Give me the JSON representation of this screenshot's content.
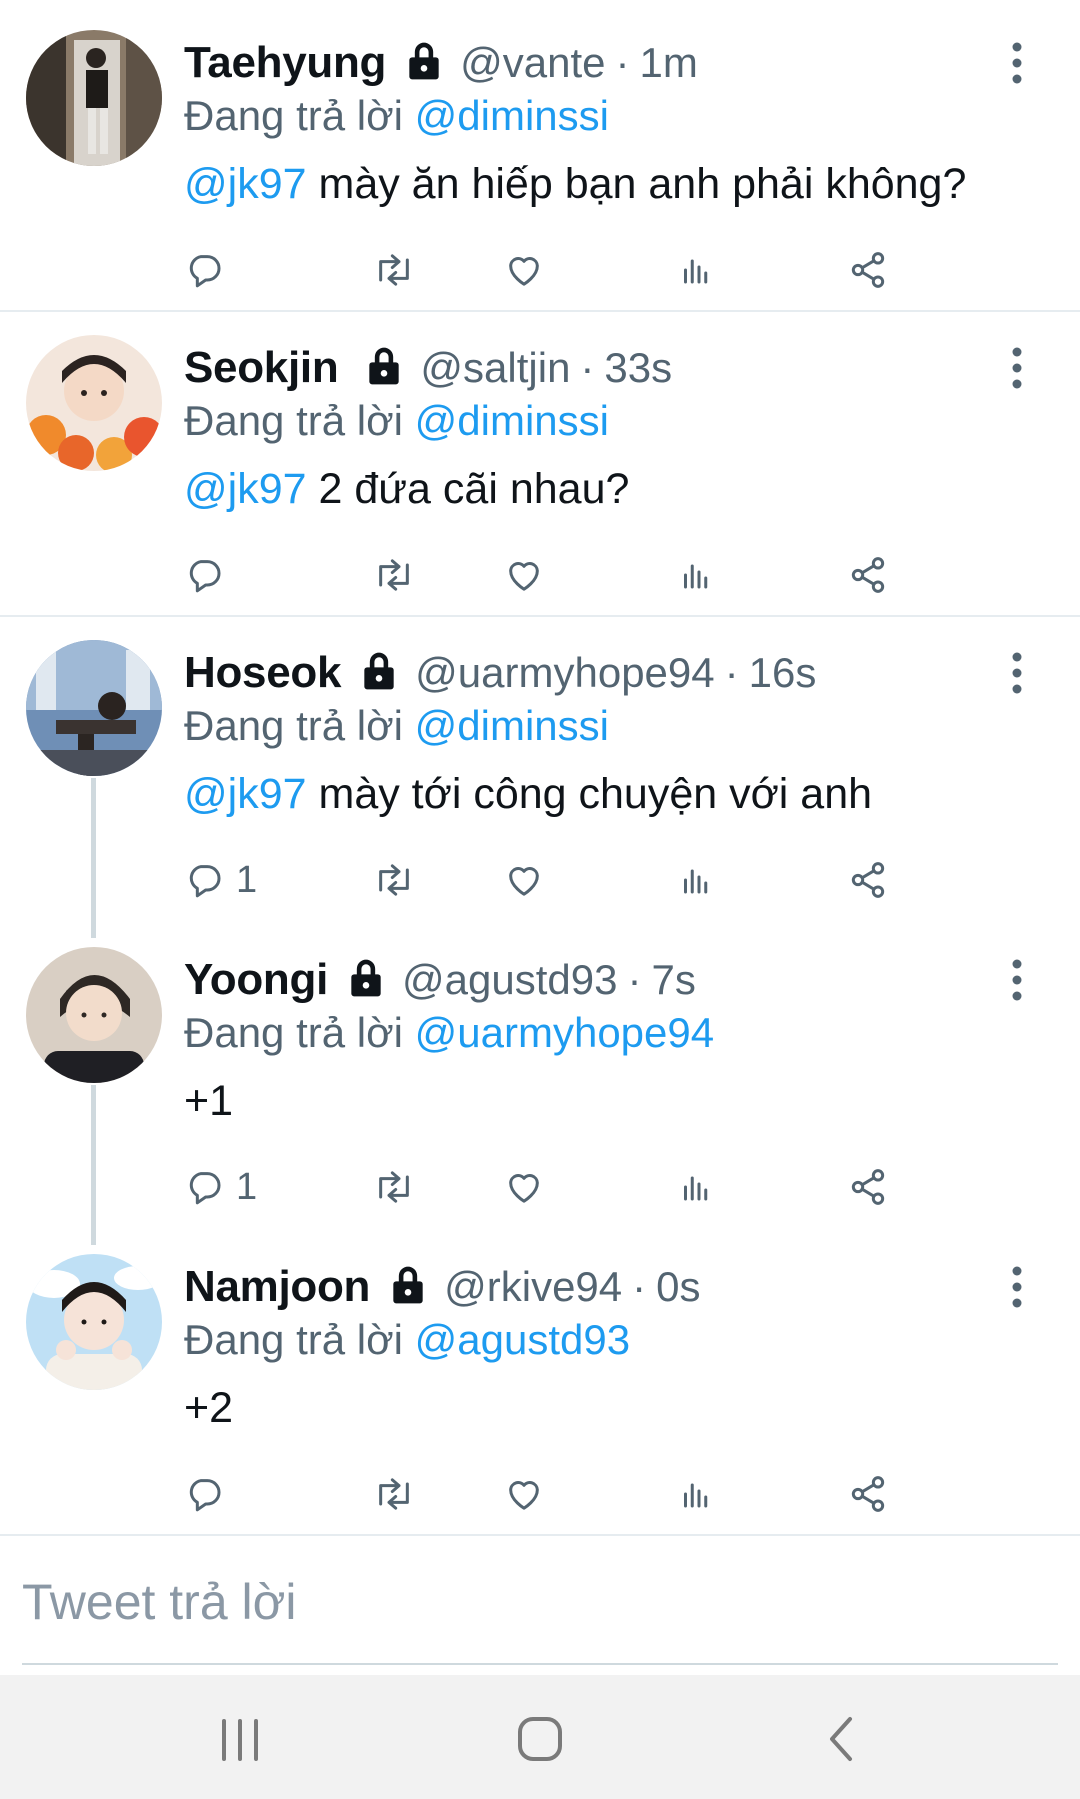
{
  "tweets": [
    {
      "name": "Taehyung",
      "handle": "@vante",
      "time": "1m",
      "replying_prefix": "Đang trả lời ",
      "replying_to": "@diminssi",
      "mention": "@jk97",
      "text": " mày ăn hiếp bạn anh phải không?",
      "reply_count": ""
    },
    {
      "name": "Seokjin",
      "handle": "@saltjin",
      "time": "33s",
      "replying_prefix": "Đang trả lời ",
      "replying_to": "@diminssi",
      "mention": "@jk97",
      "text": " 2 đứa cãi nhau?",
      "reply_count": ""
    },
    {
      "name": "Hoseok",
      "handle": "@uarmyhope94",
      "time": "16s",
      "replying_prefix": "Đang trả lời ",
      "replying_to": "@diminssi",
      "mention": "@jk97",
      "text": " mày tới công chuyện với anh",
      "reply_count": "1"
    },
    {
      "name": "Yoongi",
      "handle": "@agustd93",
      "time": "7s",
      "replying_prefix": "Đang trả lời ",
      "replying_to": "@uarmyhope94",
      "mention": "",
      "text": "+1",
      "reply_count": "1"
    },
    {
      "name": "Namjoon",
      "handle": "@rkive94",
      "time": "0s",
      "replying_prefix": "Đang trả lời ",
      "replying_to": "@agustd93",
      "mention": "",
      "text": "+2",
      "reply_count": ""
    }
  ],
  "separator_dot": "·",
  "compose": {
    "placeholder": "Tweet trả lời"
  },
  "icons": {
    "lock": "lock-icon",
    "more": "more-vertical-icon",
    "reply": "reply-icon",
    "retweet": "retweet-icon",
    "like": "heart-icon",
    "analytics": "analytics-icon",
    "share": "share-icon",
    "nav_recents": "recents-icon",
    "nav_home": "home-icon",
    "nav_back": "back-icon"
  },
  "colors": {
    "mention": "#1d9bf0",
    "secondary_text": "#536471",
    "primary_text": "#0f1419",
    "icon": "#536471",
    "navbar": "#f2f2f2"
  }
}
